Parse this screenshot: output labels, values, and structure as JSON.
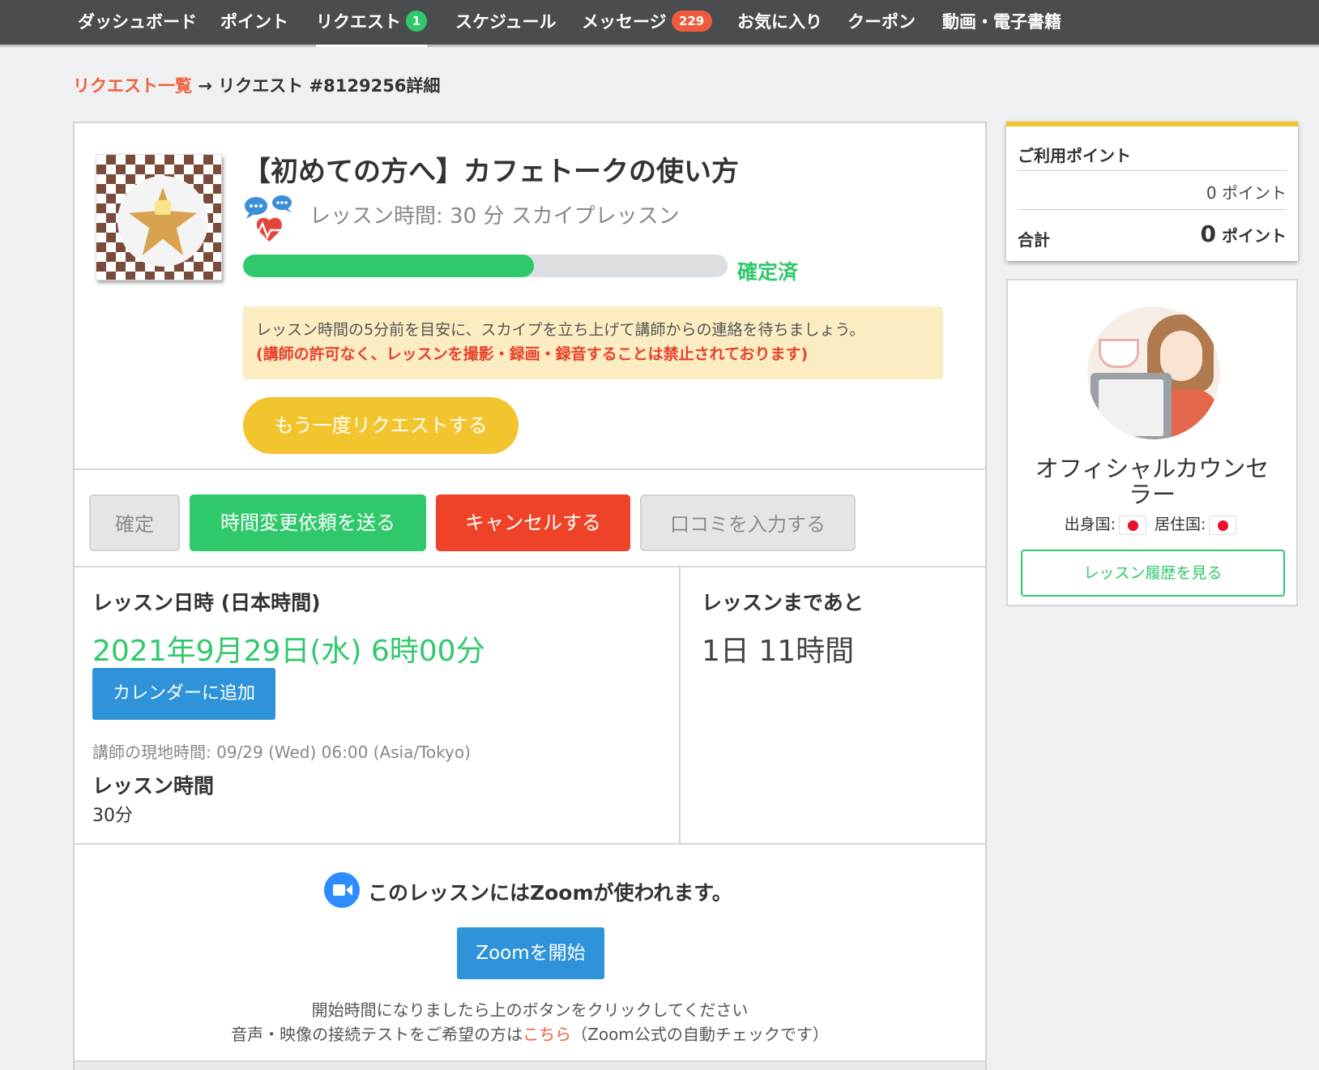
{
  "nav": {
    "items": [
      {
        "label": "ダッシュボード"
      },
      {
        "label": "ポイント"
      },
      {
        "label": "リクエスト",
        "badge": "1"
      },
      {
        "label": "スケジュール"
      },
      {
        "label": "メッセージ",
        "badge": "229"
      },
      {
        "label": "お気に入り"
      },
      {
        "label": "クーポン"
      },
      {
        "label": "動画・電子書籍"
      }
    ],
    "active": "リクエスト"
  },
  "breadcrumb": {
    "link": "リクエスト一覧",
    "separator": "→",
    "current": "リクエスト #8129256詳細"
  },
  "lesson": {
    "title": "【初めての方へ】カフェトークの使い方",
    "meta": "レッスン時間: 30 分 スカイプレッスン",
    "progress_fraction": 0.6,
    "status": "確定済",
    "notice_text": "レッスン時間の5分前を目安に、スカイプを立ち上げて講師からの連絡を待ちましょう。",
    "notice_warning": "(講師の許可なく、レッスンを撮影・録画・録音することは禁止されております)",
    "rerequest_label": "もう一度リクエストする"
  },
  "actions": {
    "confirm": "確定",
    "reschedule": "時間変更依頼を送る",
    "cancel": "キャンセルする",
    "review": "口コミを入力する"
  },
  "schedule": {
    "heading": "レッスン日時 (日本時間)",
    "datetime": "2021年9月29日(水) 6時00分",
    "calendar_button": "カレンダーに追加",
    "local_time": "講師の現地時間: 09/29 (Wed) 06:00 (Asia/Tokyo)",
    "duration_heading": "レッスン時間",
    "duration_value": "30分",
    "until_heading": "レッスンまであと",
    "until_value": "1日 11時間"
  },
  "zoom": {
    "note": "このレッスンにはZoomが使われます。",
    "start_button": "Zoomを開始",
    "hint1": "開始時間になりましたら上のボタンをクリックしてください",
    "hint2_prefix": "音声・映像の接続テストをご希望の方は",
    "hint2_link": "こちら",
    "hint2_suffix": "（Zoom公式の自動チェックです）"
  },
  "points": {
    "title": "ご利用ポイント",
    "used": "0 ポイント",
    "total_label": "合計",
    "total_value": "0",
    "total_unit": "ポイント"
  },
  "teacher": {
    "name": "オフィシャルカウンセラー",
    "origin_label": "出身国:",
    "residence_label": "居住国:",
    "history_button": "レッスン履歴を見る"
  },
  "colors": {
    "accent_green": "#2fc96c",
    "accent_red": "#ee4329",
    "accent_yellow": "#f2c42d",
    "accent_blue": "#2e93d8",
    "link_orange": "#f0603c"
  }
}
